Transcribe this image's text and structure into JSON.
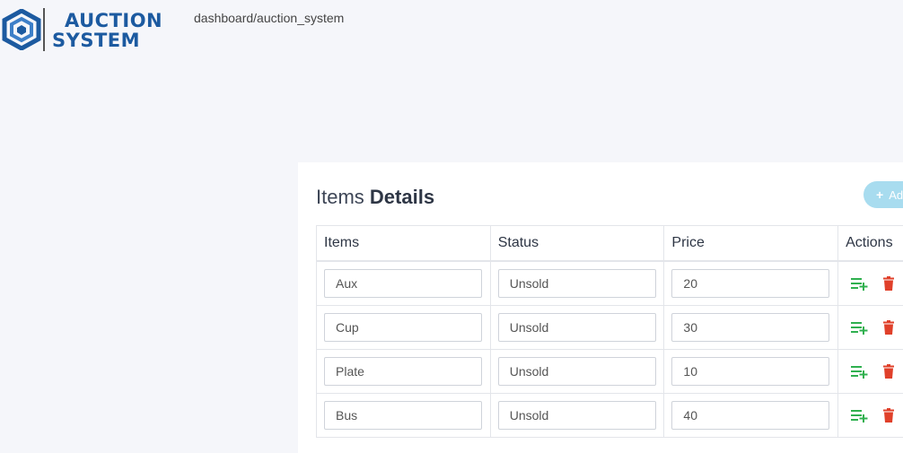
{
  "header": {
    "logo_line1": "AUCTION",
    "logo_line2": "SYSTEM",
    "breadcrumb": "dashboard/auction_system"
  },
  "card": {
    "title_light": "Items ",
    "title_bold": "Details",
    "add_button_label": "Ad",
    "add_icon": "plus-icon"
  },
  "table": {
    "headers": [
      "Items",
      "Status",
      "Price",
      "Actions"
    ],
    "rows": [
      {
        "item": "Aux",
        "status": "Unsold",
        "price": "20"
      },
      {
        "item": "Cup",
        "status": "Unsold",
        "price": "30"
      },
      {
        "item": "Plate",
        "status": "Unsold",
        "price": "10"
      },
      {
        "item": "Bus",
        "status": "Unsold",
        "price": "40"
      }
    ],
    "action_icons": [
      "playlist-add-icon",
      "trash-icon"
    ]
  },
  "colors": {
    "brand": "#1c5aa0",
    "add_button": "#a8dcef",
    "action_add": "#2fb04f",
    "action_delete": "#e0402a",
    "background": "#f5f6fa"
  }
}
